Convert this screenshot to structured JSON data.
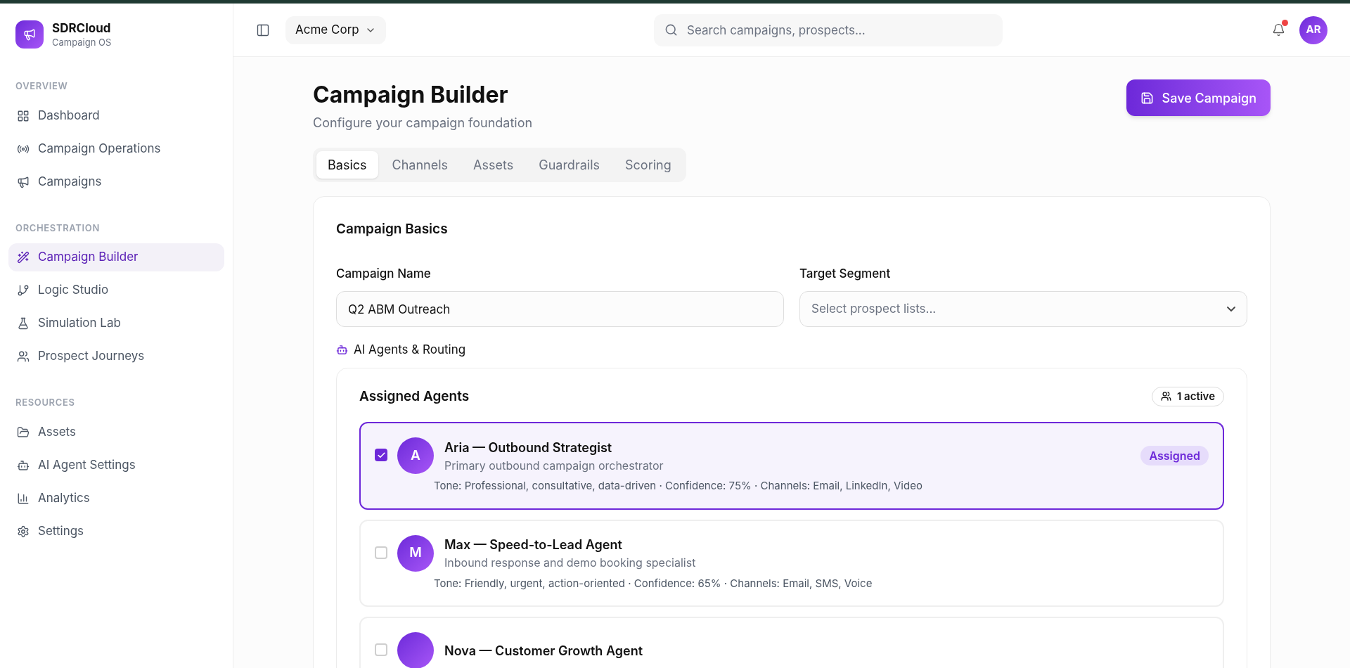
{
  "sidebar": {
    "brand": {
      "name": "SDRCloud",
      "subtitle": "Campaign OS"
    },
    "sections": [
      {
        "title": "OVERVIEW",
        "items": [
          {
            "label": "Dashboard",
            "selected": false
          },
          {
            "label": "Campaign Operations",
            "selected": false
          },
          {
            "label": "Campaigns",
            "selected": false
          }
        ]
      },
      {
        "title": "ORCHESTRATION",
        "items": [
          {
            "label": "Campaign Builder",
            "selected": true
          },
          {
            "label": "Logic Studio",
            "selected": false
          },
          {
            "label": "Simulation Lab",
            "selected": false
          },
          {
            "label": "Prospect Journeys",
            "selected": false
          }
        ]
      },
      {
        "title": "RESOURCES",
        "items": [
          {
            "label": "Assets",
            "selected": false
          },
          {
            "label": "AI Agent Settings",
            "selected": false
          },
          {
            "label": "Analytics",
            "selected": false
          },
          {
            "label": "Settings",
            "selected": false
          }
        ]
      }
    ]
  },
  "header": {
    "workspace": "Acme Corp",
    "search": {
      "placeholder": "Search campaigns, prospects..."
    },
    "notifications": {
      "unread": true
    },
    "avatar": "AR"
  },
  "page": {
    "title": "Campaign Builder",
    "subtitle": "Configure your campaign foundation",
    "save_button": "Save Campaign",
    "tabs": [
      {
        "label": "Basics",
        "selected": true
      },
      {
        "label": "Channels",
        "selected": false
      },
      {
        "label": "Assets",
        "selected": false
      },
      {
        "label": "Guardrails",
        "selected": false
      },
      {
        "label": "Scoring",
        "selected": false
      }
    ],
    "basics": {
      "title": "Campaign Basics",
      "campaign_name": {
        "label": "Campaign Name",
        "value": "Q2 ABM Outreach"
      },
      "target_segment": {
        "label": "Target Segment",
        "placeholder": "Select prospect lists..."
      },
      "agents_heading": "AI Agents & Routing",
      "agents_card": {
        "title": "Assigned Agents",
        "badge": "1 active",
        "agents": [
          {
            "initial": "A",
            "name": "Aria — Outbound Strategist",
            "description": "Primary outbound campaign orchestrator",
            "details": "Tone: Professional, consultative, data-driven · Confidence: 75% · Channels: Email, LinkedIn, Video",
            "checked": true,
            "badge": "Assigned"
          },
          {
            "initial": "M",
            "name": "Max — Speed-to-Lead Agent",
            "description": "Inbound response and demo booking specialist",
            "details": "Tone: Friendly, urgent, action-oriented · Confidence: 65% · Channels: Email, SMS, Voice",
            "checked": false
          },
          {
            "name": "Nova — Customer Growth Agent",
            "checked": false
          }
        ]
      }
    }
  }
}
